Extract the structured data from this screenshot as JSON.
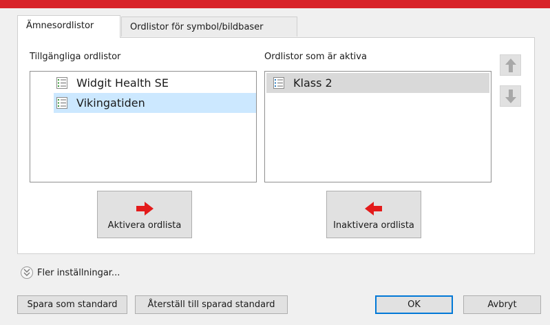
{
  "tabs": [
    {
      "label": "Ämnesordlistor",
      "active": true
    },
    {
      "label": "Ordlistor för symbol/bildbaser",
      "active": false
    }
  ],
  "available": {
    "label": "Tillgängliga ordlistor",
    "items": [
      {
        "label": "Widgit Health SE",
        "selected": false
      },
      {
        "label": "Vikingatiden",
        "selected": true
      }
    ]
  },
  "active_lists": {
    "label": "Ordlistor som är aktiva",
    "items": [
      {
        "label": "Klass 2",
        "selected": true
      }
    ]
  },
  "buttons": {
    "activate": "Aktivera ordlista",
    "deactivate": "Inaktivera ordlista",
    "save_default": "Spara som standard",
    "restore_default": "Återställ till sparad standard",
    "ok": "OK",
    "cancel": "Avbryt"
  },
  "more_settings": "Fler inställningar...",
  "colors": {
    "accent_bar": "#d8232a",
    "arrow_red": "#e31b1b",
    "selection": "#cce8ff",
    "default_button_border": "#0078d7"
  },
  "icons": {
    "list_item": "list-icon",
    "move_up": "arrow-up-icon",
    "move_down": "arrow-down-icon",
    "activate": "arrow-right-icon",
    "deactivate": "arrow-left-icon",
    "more": "chevron-double-down-icon"
  }
}
